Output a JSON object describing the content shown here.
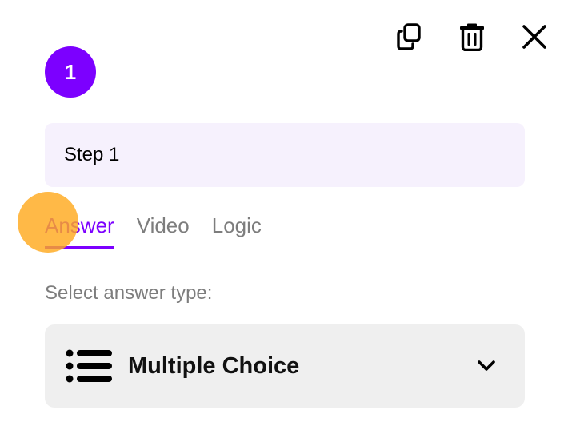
{
  "step": {
    "number": "1",
    "title_value": "Step 1"
  },
  "toolbar": {
    "duplicate_icon": "copy-icon",
    "delete_icon": "trash-icon",
    "close_icon": "close-icon"
  },
  "tabs": [
    {
      "label": "Answer",
      "active": true
    },
    {
      "label": "Video",
      "active": false
    },
    {
      "label": "Logic",
      "active": false
    }
  ],
  "answer_type": {
    "label": "Select answer type:",
    "selected": "Multiple Choice",
    "icon": "list-icon",
    "dropdown_icon": "chevron-down-icon"
  },
  "colors": {
    "accent": "#7c00ff",
    "input_bg": "#f6f1fd",
    "select_bg": "#efefef",
    "muted_text": "#7d7d7d",
    "touch_indicator": "#ffaa1e"
  }
}
